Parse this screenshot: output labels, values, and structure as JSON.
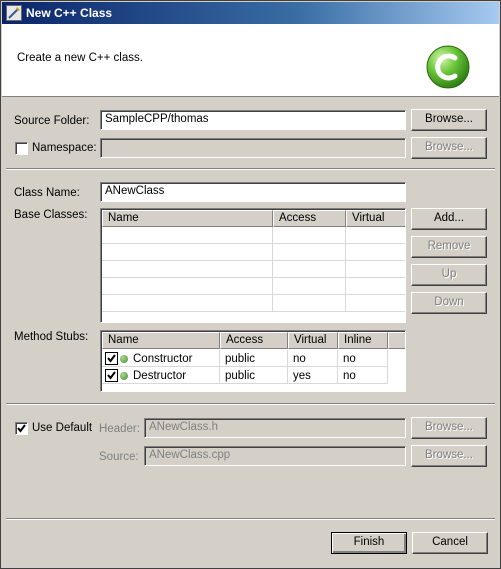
{
  "window": {
    "title": "New C++ Class",
    "description": "Create a new C++ class."
  },
  "source_folder": {
    "label": "Source Folder:",
    "value": "SampleCPP/thomas",
    "browse_label": "Browse..."
  },
  "namespace": {
    "label": "Namespace:",
    "checked": false,
    "value": "",
    "browse_label": "Browse..."
  },
  "class_name": {
    "label": "Class Name:",
    "value": "ANewClass"
  },
  "base_classes": {
    "label": "Base Classes:",
    "columns": [
      "Name",
      "Access",
      "Virtual"
    ],
    "rows": [],
    "buttons": {
      "add": "Add...",
      "remove": "Remove",
      "up": "Up",
      "down": "Down"
    }
  },
  "method_stubs": {
    "label": "Method Stubs:",
    "columns": [
      "Name",
      "Access",
      "Virtual",
      "Inline"
    ],
    "rows": [
      {
        "checked": true,
        "name": "Constructor",
        "access": "public",
        "virtual": "no",
        "inline": "no"
      },
      {
        "checked": true,
        "name": "Destructor",
        "access": "public",
        "virtual": "yes",
        "inline": "no"
      }
    ]
  },
  "use_default": {
    "label": "Use Default",
    "checked": true
  },
  "header": {
    "label": "Header:",
    "value": "ANewClass.h",
    "browse_label": "Browse..."
  },
  "source": {
    "label": "Source:",
    "value": "ANewClass.cpp",
    "browse_label": "Browse..."
  },
  "footer": {
    "finish_label": "Finish",
    "cancel_label": "Cancel"
  },
  "colors": {
    "title_bar": "#0a246a",
    "dialog_bg": "#d4d0c8",
    "logo_green": "#3fa020"
  },
  "icons": {
    "window_icon": "wizard-icon",
    "banner_logo": "cpp-logo-icon",
    "method_icon": "green-method-dot-icon"
  }
}
